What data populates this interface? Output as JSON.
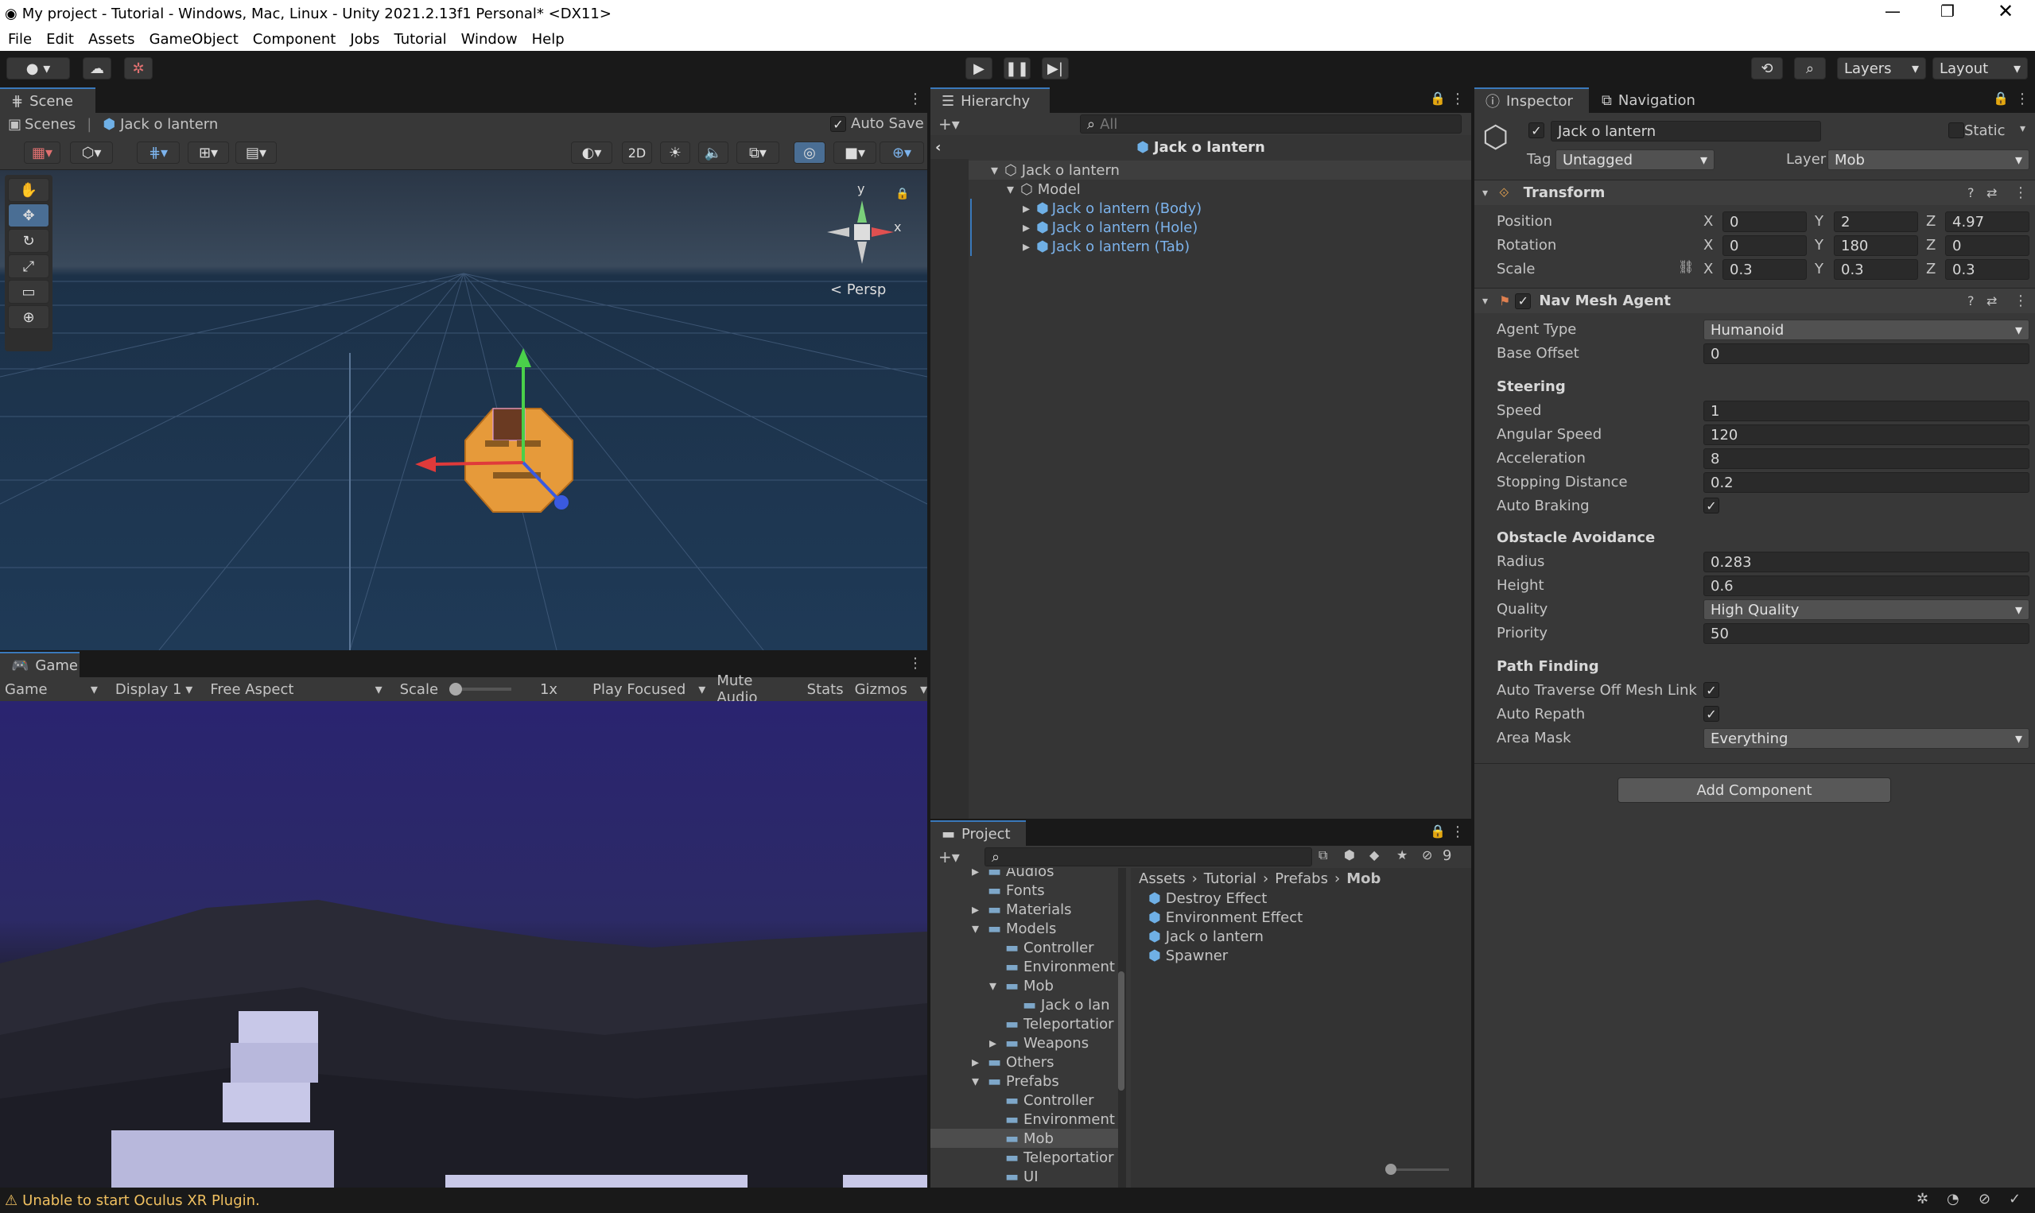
{
  "title": "My project - Tutorial - Windows, Mac, Linux - Unity 2021.2.13f1 Personal* <DX11>",
  "menu": [
    "File",
    "Edit",
    "Assets",
    "GameObject",
    "Component",
    "Jobs",
    "Tutorial",
    "Window",
    "Help"
  ],
  "toolbar": {
    "layers": "Layers",
    "layout": "Layout"
  },
  "scene": {
    "tab": "Scene",
    "breadcrumb_root": "Scenes",
    "breadcrumb_item": "Jack o lantern",
    "auto_save": "Auto Save",
    "mode_2d": "2D",
    "persp": "< Persp",
    "gizmo_x": "x",
    "gizmo_y": "y"
  },
  "game": {
    "tab": "Game",
    "view": "Game",
    "display": "Display 1",
    "aspect": "Free Aspect",
    "scale_label": "Scale",
    "scale_val": "1x",
    "play_focused": "Play Focused",
    "mute": "Mute Audio",
    "stats": "Stats",
    "gizmos": "Gizmos"
  },
  "hierarchy": {
    "tab": "Hierarchy",
    "search_placeholder": "All",
    "prefab_title": "Jack o lantern",
    "items": [
      {
        "label": "Jack o lantern"
      },
      {
        "label": "Model"
      },
      {
        "label": "Jack o lantern (Body)"
      },
      {
        "label": "Jack o lantern (Hole)"
      },
      {
        "label": "Jack o lantern (Tab)"
      }
    ]
  },
  "project": {
    "tab": "Project",
    "count": "9",
    "tree": [
      "Audios",
      "Fonts",
      "Materials",
      "Models",
      "Controller",
      "Environment",
      "Mob",
      "Jack o lan",
      "Teleportatior",
      "Weapons",
      "Others",
      "Prefabs",
      "Controller",
      "Environment",
      "Mob",
      "Teleportatior",
      "UI"
    ],
    "breadcrumb": [
      "Assets",
      "Tutorial",
      "Prefabs",
      "Mob"
    ],
    "assets": [
      "Destroy Effect",
      "Environment Effect",
      "Jack o lantern",
      "Spawner"
    ]
  },
  "inspector": {
    "tab": "Inspector",
    "tab2": "Navigation",
    "name": "Jack o lantern",
    "static": "Static",
    "tag_label": "Tag",
    "tag": "Untagged",
    "layer_label": "Layer",
    "layer": "Mob",
    "transform": {
      "title": "Transform",
      "position_label": "Position",
      "rotation_label": "Rotation",
      "scale_label": "Scale",
      "position": [
        "0",
        "2",
        "4.97"
      ],
      "rotation": [
        "0",
        "180",
        "0"
      ],
      "scale": [
        "0.3",
        "0.3",
        "0.3"
      ],
      "axes": [
        "X",
        "Y",
        "Z"
      ]
    },
    "nav": {
      "title": "Nav Mesh Agent",
      "agent_type_label": "Agent Type",
      "agent_type": "Humanoid",
      "base_offset_label": "Base Offset",
      "base_offset": "0",
      "steering": "Steering",
      "speed_label": "Speed",
      "speed": "1",
      "angular_label": "Angular Speed",
      "angular": "120",
      "accel_label": "Acceleration",
      "accel": "8",
      "stop_label": "Stopping Distance",
      "stop": "0.2",
      "braking_label": "Auto Braking",
      "obstacle": "Obstacle Avoidance",
      "radius_label": "Radius",
      "radius": "0.283",
      "height_label": "Height",
      "height": "0.6",
      "quality_label": "Quality",
      "quality": "High Quality",
      "priority_label": "Priority",
      "priority": "50",
      "path": "Path Finding",
      "traverse_label": "Auto Traverse Off Mesh Link",
      "repath_label": "Auto Repath",
      "area_label": "Area Mask",
      "area": "Everything"
    },
    "add_component": "Add Component"
  },
  "status": "Unable to start Oculus XR Plugin.",
  "colors": {
    "accent": "#3a79bb",
    "warning": "#f0c060",
    "sky": "#2a2470"
  }
}
